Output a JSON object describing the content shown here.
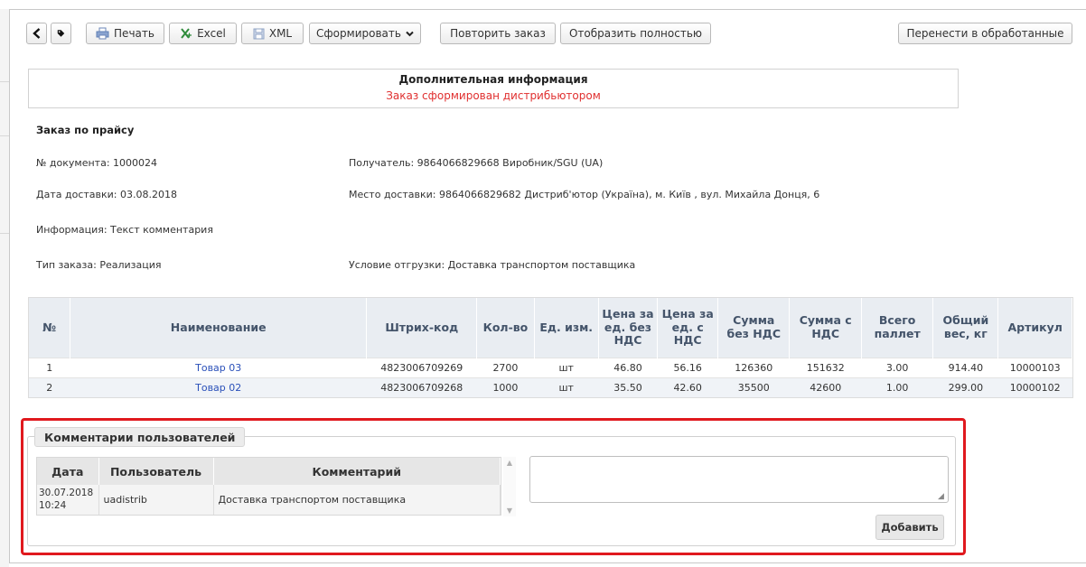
{
  "toolbar": {
    "back_icon": "chevron-left-icon",
    "tag_icon": "tag-icon",
    "print_label": "Печать",
    "excel_label": "Excel",
    "xml_label": "XML",
    "form_label": "Сформировать",
    "repeat_order_label": "Повторить заказ",
    "show_full_label": "Отобразить полностью",
    "move_processed_label": "Перенести в обработанные"
  },
  "additional_info": {
    "title": "Дополнительная информация",
    "subtitle": "Заказ сформирован дистрибьютором"
  },
  "order": {
    "type_heading": "Заказ по прайсу",
    "document_number": "№ документа: 1000024",
    "delivery_date": "Дата доставки: 03.08.2018",
    "information": "Информация: Текст комментария",
    "order_type": "Тип заказа: Реализация",
    "recipient": "Получатель: 9864066829668 Виробник/SGU (UA)",
    "delivery_place": "Место доставки: 9864066829682 Дистриб'ютор (Україна), м. Київ , вул. Михайла Донця, 6",
    "shipping_condition": "Условие отгрузки: Доставка транспортом поставщика"
  },
  "items_table": {
    "headers": [
      "№",
      "Наименование",
      "Штрих-код",
      "Кол-во",
      "Ед. изм.",
      "Цена за ед. без НДС",
      "Цена за ед. с НДС",
      "Сумма без НДС",
      "Сумма с НДС",
      "Всего паллет",
      "Общий вес, кг",
      "Артикул"
    ],
    "rows": [
      [
        "1",
        "Товар 03",
        "4823006709269",
        "2700",
        "шт",
        "46.80",
        "56.16",
        "126360",
        "151632",
        "3.00",
        "914.40",
        "10000103"
      ],
      [
        "2",
        "Товар 02",
        "4823006709268",
        "1000",
        "шт",
        "35.50",
        "42.60",
        "35500",
        "42600",
        "1.00",
        "299.00",
        "10000102"
      ]
    ]
  },
  "comments": {
    "legend": "Комментарии пользователей",
    "headers": [
      "Дата",
      "Пользователь",
      "Комментарий"
    ],
    "rows": [
      [
        "30.07.2018 10:24",
        "uadistrib",
        "Доставка транспортом поставщика"
      ]
    ],
    "input_value": "",
    "add_label": "Добавить"
  },
  "colors": {
    "highlight": "#e0191e",
    "info_red": "#e03030",
    "link_blue": "#2a50b9",
    "header_bg": "#e9edf2"
  }
}
